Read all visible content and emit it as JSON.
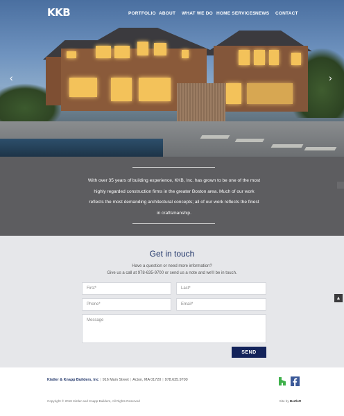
{
  "header": {
    "logo": "KKB",
    "nav": [
      "PORTFOLIO",
      "ABOUT",
      "WHAT WE DO",
      "HOME SERVICES",
      "NEWS",
      "CONTACT"
    ],
    "prev_arrow": "‹",
    "next_arrow": "›"
  },
  "about": {
    "text": "With over 35 years of building experience, KKB, Inc. has grown to be one of the most highly regarded construction firms in the greater Boston area. Much of our work reflects the most demanding architectural concepts; all of our work reflects the finest in craftsmanship."
  },
  "contact": {
    "title": "Get in touch",
    "subtitle_line1": "Have a question or need more information?",
    "subtitle_line2": "Give us a call at 978-635-9700 or send us a note and we'll be in touch.",
    "first_placeholder": "First*",
    "last_placeholder": "Last*",
    "phone_placeholder": "Phone*",
    "email_placeholder": "Email*",
    "message_placeholder": "Message",
    "send_label": "SEND",
    "to_top": "▲"
  },
  "footer": {
    "company": "Kistler & Knapp Builders, Inc",
    "address": "916 Main Street",
    "city": "Acton, MA 01720",
    "phone": "978.635.9700",
    "copyright": "Copyright © 2018 Kistler and Knapp Builders, All Rights Reserved",
    "siteby_prefix": "Site by",
    "siteby_name": "Bertlett"
  },
  "colors": {
    "navy": "#13235a",
    "about_bg": "#5d5d60",
    "contact_bg": "#e6e7ea"
  }
}
